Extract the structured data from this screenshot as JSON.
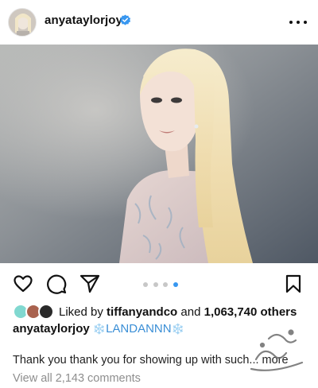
{
  "header": {
    "username": "anyataylorjoy",
    "verified_icon": "verified-badge-icon",
    "more_icon": "more-options-icon"
  },
  "photo": {
    "carousel_count": 4,
    "carousel_active_index": 3
  },
  "actions": {
    "like_icon": "heart-icon",
    "comment_icon": "comment-icon",
    "share_icon": "send-icon",
    "save_icon": "bookmark-icon"
  },
  "likes": {
    "prefix": "Liked by ",
    "user": "tiffanyandco",
    "middle": " and ",
    "count": "1,063,740 others"
  },
  "caption": {
    "username": "anyataylorjoy",
    "snow_left": "❄️",
    "text": "LANDANNN",
    "snow_right": "❄️"
  },
  "comment_preview": "Thank you thank you for showing up with such... more",
  "view_all": "View all 2,143 comments",
  "colors": {
    "accent": "#3797f0",
    "text": "#111111",
    "muted": "#8e8e8e"
  }
}
